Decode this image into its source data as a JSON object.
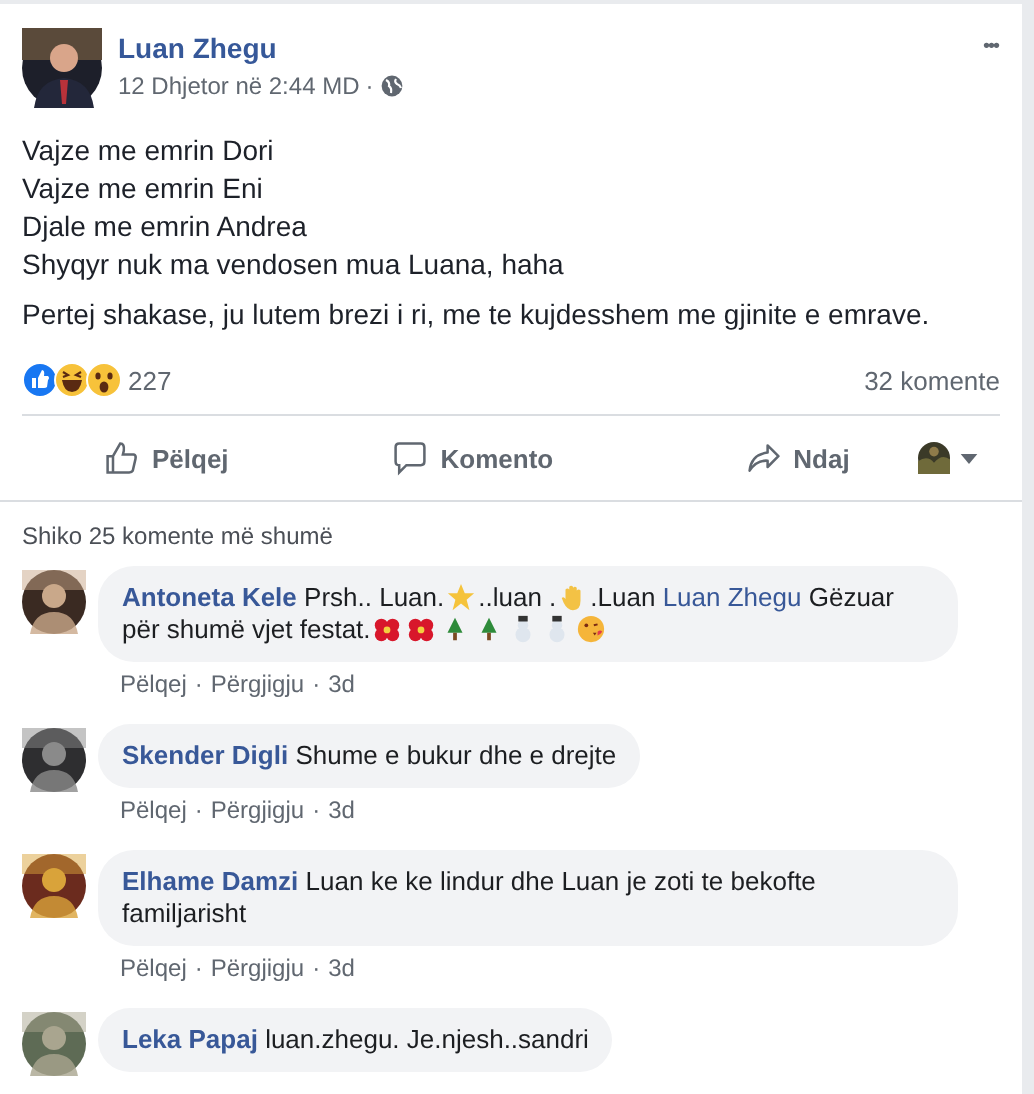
{
  "post": {
    "author": "Luan Zhegu",
    "time": "12 Dhjetor në 2:44 MD",
    "separator": "·",
    "more": "•••",
    "paragraphs": [
      [
        "Vajze me emrin Dori",
        "Vajze me emrin Eni",
        "Djale me emrin Andrea",
        "Shyqyr nuk ma vendosen mua Luana, haha"
      ],
      [
        "Pertej shakase, ju lutem brezi i ri, me te kujdesshem me gjinite e emrave."
      ]
    ],
    "reactions": [
      {
        "kind": "like"
      },
      {
        "kind": "haha"
      },
      {
        "kind": "wow"
      }
    ],
    "reaction_count": "227",
    "comment_count": "32 komente",
    "actions": [
      {
        "kind": "like",
        "label": "Pëlqej"
      },
      {
        "kind": "comment",
        "label": "Komento"
      },
      {
        "kind": "share",
        "label": "Ndaj"
      }
    ]
  },
  "comments_section": {
    "more_link": "Shiko 25 komente më shumë",
    "comments": [
      {
        "author": "Antoneta Kele",
        "segments": [
          {
            "kind": "text",
            "text": "Prsh.. Luan."
          },
          {
            "kind": "star"
          },
          {
            "kind": "text",
            "text": "..luan ."
          },
          {
            "kind": "hand"
          },
          {
            "kind": "text",
            "text": ".Luan "
          },
          {
            "kind": "link",
            "text": "Luan Zhegu"
          },
          {
            "kind": "text",
            "text": " Gëzuar për shumë vjet festat."
          },
          {
            "kind": "flower"
          },
          {
            "kind": "flower"
          },
          {
            "kind": "tree"
          },
          {
            "kind": "tree"
          },
          {
            "kind": "snowman"
          },
          {
            "kind": "snowman"
          },
          {
            "kind": "kiss"
          }
        ],
        "like": "Pëlqej",
        "dots": [
          "·",
          "·"
        ],
        "reply": "Përgjigju",
        "age": "3d"
      },
      {
        "author": "Skender Digli",
        "segments": [
          {
            "kind": "text",
            "text": "Shume e bukur dhe e drejte"
          }
        ],
        "like": "Pëlqej",
        "dots": [
          "·",
          "·"
        ],
        "reply": "Përgjigju",
        "age": "3d"
      },
      {
        "author": "Elhame Damzi",
        "segments": [
          {
            "kind": "text",
            "text": "Luan ke ke lindur dhe Luan je zoti te bekofte familjarisht"
          }
        ],
        "like": "Pëlqej",
        "dots": [
          "·",
          "·"
        ],
        "reply": "Përgjigju",
        "age": "3d"
      },
      {
        "author": "Leka Papaj",
        "segments": [
          {
            "kind": "text",
            "text": "luan.zhegu. Je.njesh..sandri"
          }
        ]
      }
    ]
  }
}
